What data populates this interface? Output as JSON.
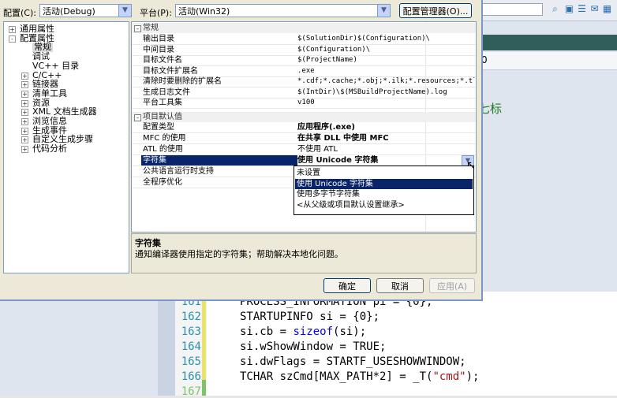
{
  "toolbar": {
    "config_label": "配置(C):",
    "config_value": "活动(Debug)",
    "platform_label": "平台(P):",
    "platform_value": "活动(Win32)",
    "config_manager_button": "配置管理器(O)..."
  },
  "tree": {
    "items": [
      {
        "label": "通用属性",
        "expander": "+"
      },
      {
        "label": "配置属性",
        "expander": "-"
      },
      {
        "label": "常规",
        "selected": true
      },
      {
        "label": "调试"
      },
      {
        "label": "VC++ 目录"
      },
      {
        "label": "C/C++",
        "expander": "+"
      },
      {
        "label": "链接器",
        "expander": "+"
      },
      {
        "label": "清单工具",
        "expander": "+"
      },
      {
        "label": "资源",
        "expander": "+"
      },
      {
        "label": "XML 文档生成器",
        "expander": "+"
      },
      {
        "label": "浏览信息",
        "expander": "+"
      },
      {
        "label": "生成事件",
        "expander": "+"
      },
      {
        "label": "自定义生成步骤",
        "expander": "+"
      },
      {
        "label": "代码分析",
        "expander": "+"
      }
    ]
  },
  "grid": {
    "section_general": "常规",
    "general_rows": [
      {
        "name": "输出目录",
        "value": "$(SolutionDir)$(Configuration)\\"
      },
      {
        "name": "中间目录",
        "value": "$(Configuration)\\"
      },
      {
        "name": "目标文件名",
        "value": "$(ProjectName)"
      },
      {
        "name": "目标文件扩展名",
        "value": ".exe"
      },
      {
        "name": "清除时要删除的扩展名",
        "value": "*.cdf;*.cache;*.obj;*.ilk;*.resources;*.tlb;*"
      },
      {
        "name": "生成日志文件",
        "value": "$(IntDir)\\$(MSBuildProjectName).log"
      },
      {
        "name": "平台工具集",
        "value": "v100"
      }
    ],
    "section_defaults": "项目默认值",
    "default_rows": [
      {
        "name": "配置类型",
        "value": "应用程序(.exe)"
      },
      {
        "name": "MFC 的使用",
        "value": "在共享 DLL 中使用 MFC"
      },
      {
        "name": "ATL 的使用",
        "value": "不使用 ATL"
      },
      {
        "name": "字符集",
        "value": "使用 Unicode 字符集"
      },
      {
        "name": "公共语言运行时支持",
        "value": ""
      },
      {
        "name": "全程序优化",
        "value": ""
      }
    ]
  },
  "dropdown": {
    "options": [
      "未设置",
      "使用 Unicode 字符集",
      "使用多字节字符集",
      "<从父级或项目默认设置继承>"
    ],
    "selected_index": 1
  },
  "description": {
    "title": "字符集",
    "text": "通知编译器使用指定的字符集；帮助解决本地化问题。"
  },
  "buttons": {
    "ok": "确定",
    "cancel": "取消",
    "apply": "应用(A)"
  },
  "ide": {
    "ruler_digit": "0",
    "side_text": "七标",
    "line_numbers": [
      "161",
      "162",
      "163",
      "164",
      "165",
      "166",
      "167"
    ],
    "code_lines": [
      "PROCESS_INFORMATION pi = {0};",
      "STARTUPINFO si = {0};",
      "si.cb = sizeof(si);",
      "si.wShowWindow = TRUE;",
      "si.dwFlags = STARTF_USESHOWWINDOW;",
      "TCHAR szCmd[MAX_PATH*2] = _T(\"cmd\");",
      ""
    ]
  },
  "colors": {
    "selection": "#0a246a",
    "keyword": "#0000ff",
    "string": "#a31515",
    "line_number": "#2b91af"
  }
}
